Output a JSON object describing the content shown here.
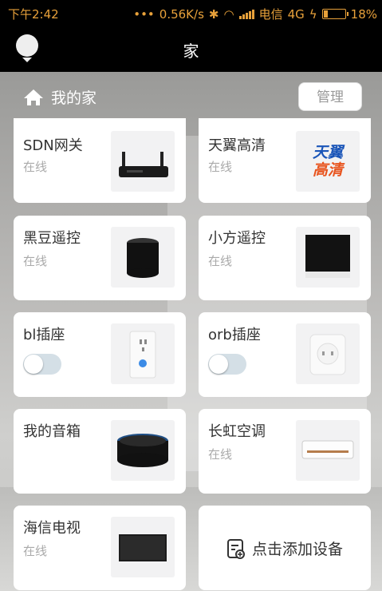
{
  "status_bar": {
    "time": "下午2:42",
    "speed": "0.56K/s",
    "carrier": "电信",
    "network": "4G",
    "battery": "18%",
    "battery_level": 0.18
  },
  "app_bar": {
    "title": "家"
  },
  "home": {
    "name": "我的家",
    "manage_label": "管理"
  },
  "devices": [
    {
      "name": "SDN网关",
      "status": "在线",
      "icon": "router-icon"
    },
    {
      "name": "天翼高清",
      "status": "在线",
      "icon": "tianyi-hd-logo",
      "logo_text": [
        "天翼",
        "高清"
      ]
    },
    {
      "name": "黑豆遥控",
      "status": "在线",
      "icon": "black-cylinder-remote-icon"
    },
    {
      "name": "小方遥控",
      "status": "在线",
      "icon": "cube-remote-icon"
    },
    {
      "name": "bl插座",
      "toggle": false,
      "icon": "smart-plug-icon"
    },
    {
      "name": "orb插座",
      "toggle": false,
      "icon": "orb-socket-icon"
    },
    {
      "name": "我的音箱",
      "status": "",
      "icon": "speaker-icon"
    },
    {
      "name": "长虹空调",
      "status": "在线",
      "icon": "air-conditioner-icon"
    },
    {
      "name": "海信电视",
      "status": "在线",
      "icon": "tv-icon"
    }
  ],
  "add_device_label": "点击添加设备",
  "colors": {
    "status_bar_text": "#e8a13a",
    "header_bg": "#000000",
    "card_bg": "#ffffff",
    "toggle_off": "#d4dfe6"
  }
}
